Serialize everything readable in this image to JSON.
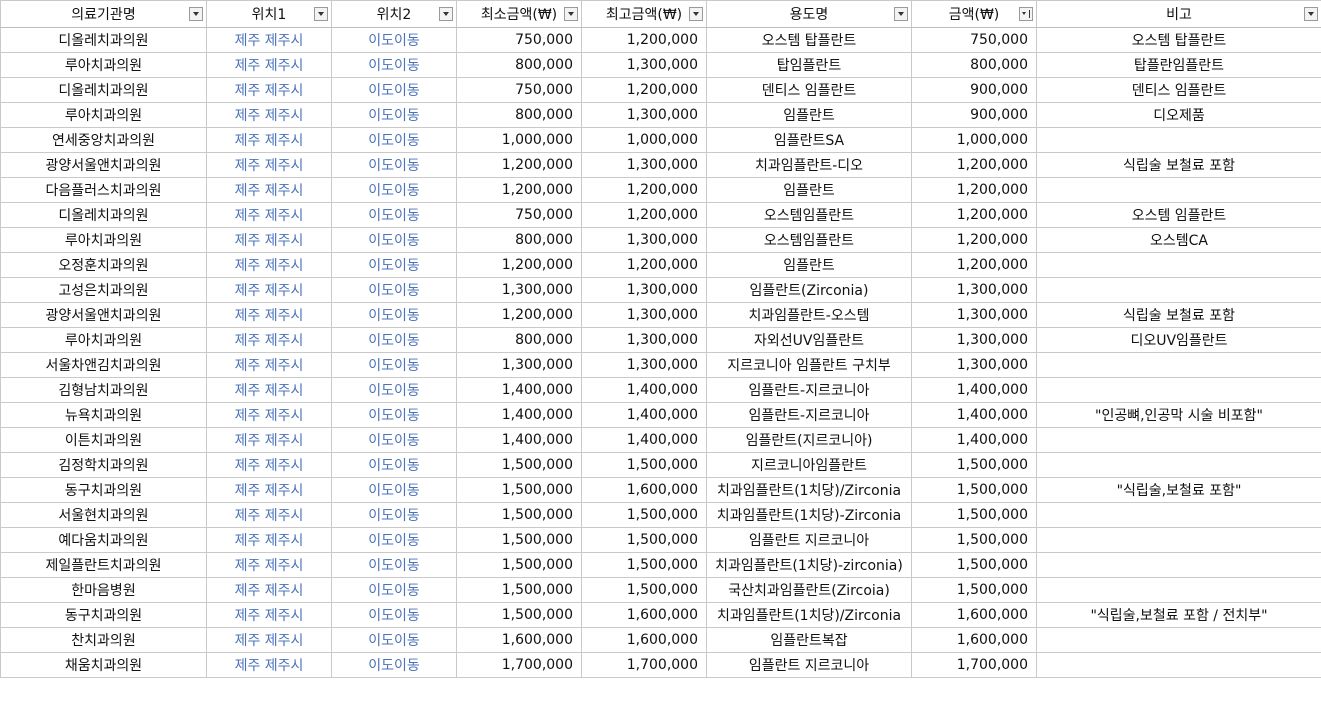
{
  "headers": [
    "의료기관명",
    "위치1",
    "위치2",
    "최소금액(₩)",
    "최고금액(₩)",
    "용도명",
    "금액(₩)",
    "비고"
  ],
  "icons": {
    "filter": "filter-dropdown-icon",
    "sorted": "sort-filter-icon"
  },
  "colors": {
    "location_text": "#4a73b8",
    "grid": "#c9c9c9"
  },
  "rows": [
    [
      "디올레치과의원",
      "제주 제주시",
      "이도이동",
      "750,000",
      "1,200,000",
      "오스템 탑플란트",
      "750,000",
      "오스템 탑플란트"
    ],
    [
      "루아치과의원",
      "제주 제주시",
      "이도이동",
      "800,000",
      "1,300,000",
      "탑임플란트",
      "800,000",
      "탑플란임플란트"
    ],
    [
      "디올레치과의원",
      "제주 제주시",
      "이도이동",
      "750,000",
      "1,200,000",
      "덴티스 임플란트",
      "900,000",
      "덴티스 임플란트"
    ],
    [
      "루아치과의원",
      "제주 제주시",
      "이도이동",
      "800,000",
      "1,300,000",
      "임플란트",
      "900,000",
      "디오제품"
    ],
    [
      "연세중앙치과의원",
      "제주 제주시",
      "이도이동",
      "1,000,000",
      "1,000,000",
      "임플란트SA",
      "1,000,000",
      ""
    ],
    [
      "광양서울앤치과의원",
      "제주 제주시",
      "이도이동",
      "1,200,000",
      "1,300,000",
      "치과임플란트-디오",
      "1,200,000",
      "식립술 보철료 포함"
    ],
    [
      "다음플러스치과의원",
      "제주 제주시",
      "이도이동",
      "1,200,000",
      "1,200,000",
      "임플란트",
      "1,200,000",
      ""
    ],
    [
      "디올레치과의원",
      "제주 제주시",
      "이도이동",
      "750,000",
      "1,200,000",
      "오스템임플란트",
      "1,200,000",
      "오스템 임플란트"
    ],
    [
      "루아치과의원",
      "제주 제주시",
      "이도이동",
      "800,000",
      "1,300,000",
      "오스템임플란트",
      "1,200,000",
      "오스템CA"
    ],
    [
      "오정훈치과의원",
      "제주 제주시",
      "이도이동",
      "1,200,000",
      "1,200,000",
      "임플란트",
      "1,200,000",
      ""
    ],
    [
      "고성은치과의원",
      "제주 제주시",
      "이도이동",
      "1,300,000",
      "1,300,000",
      "임플란트(Zirconia)",
      "1,300,000",
      ""
    ],
    [
      "광양서울앤치과의원",
      "제주 제주시",
      "이도이동",
      "1,200,000",
      "1,300,000",
      "치과임플란트-오스템",
      "1,300,000",
      "식립술 보철료 포함"
    ],
    [
      "루아치과의원",
      "제주 제주시",
      "이도이동",
      "800,000",
      "1,300,000",
      "자외선UV임플란트",
      "1,300,000",
      "디오UV임플란트"
    ],
    [
      "서울차앤김치과의원",
      "제주 제주시",
      "이도이동",
      "1,300,000",
      "1,300,000",
      "지르코니아 임플란트 구치부",
      "1,300,000",
      ""
    ],
    [
      "김형남치과의원",
      "제주 제주시",
      "이도이동",
      "1,400,000",
      "1,400,000",
      "임플란트-지르코니아",
      "1,400,000",
      ""
    ],
    [
      "뉴욕치과의원",
      "제주 제주시",
      "이도이동",
      "1,400,000",
      "1,400,000",
      "임플란트-지르코니아",
      "1,400,000",
      "\"인공뼈,인공막 시술 비포함\""
    ],
    [
      "이튼치과의원",
      "제주 제주시",
      "이도이동",
      "1,400,000",
      "1,400,000",
      "임플란트(지르코니아)",
      "1,400,000",
      ""
    ],
    [
      "김정학치과의원",
      "제주 제주시",
      "이도이동",
      "1,500,000",
      "1,500,000",
      "지르코니아임플란트",
      "1,500,000",
      ""
    ],
    [
      "동구치과의원",
      "제주 제주시",
      "이도이동",
      "1,500,000",
      "1,600,000",
      "치과임플란트(1치당)/Zirconia",
      "1,500,000",
      "\"식립술,보철료 포함\""
    ],
    [
      "서울현치과의원",
      "제주 제주시",
      "이도이동",
      "1,500,000",
      "1,500,000",
      "치과임플란트(1치당)-Zirconia",
      "1,500,000",
      ""
    ],
    [
      "예다움치과의원",
      "제주 제주시",
      "이도이동",
      "1,500,000",
      "1,500,000",
      "임플란트 지르코니아",
      "1,500,000",
      ""
    ],
    [
      "제일플란트치과의원",
      "제주 제주시",
      "이도이동",
      "1,500,000",
      "1,500,000",
      "치과임플란트(1치당)-zirconia)",
      "1,500,000",
      ""
    ],
    [
      "한마음병원",
      "제주 제주시",
      "이도이동",
      "1,500,000",
      "1,500,000",
      "국산치과임플란트(Zircoia)",
      "1,500,000",
      ""
    ],
    [
      "동구치과의원",
      "제주 제주시",
      "이도이동",
      "1,500,000",
      "1,600,000",
      "치과임플란트(1치당)/Zirconia",
      "1,600,000",
      "\"식립술,보철료 포함 / 전치부\""
    ],
    [
      "찬치과의원",
      "제주 제주시",
      "이도이동",
      "1,600,000",
      "1,600,000",
      "임플란트복잡",
      "1,600,000",
      ""
    ],
    [
      "채움치과의원",
      "제주 제주시",
      "이도이동",
      "1,700,000",
      "1,700,000",
      "임플란트 지르코니아",
      "1,700,000",
      ""
    ]
  ]
}
